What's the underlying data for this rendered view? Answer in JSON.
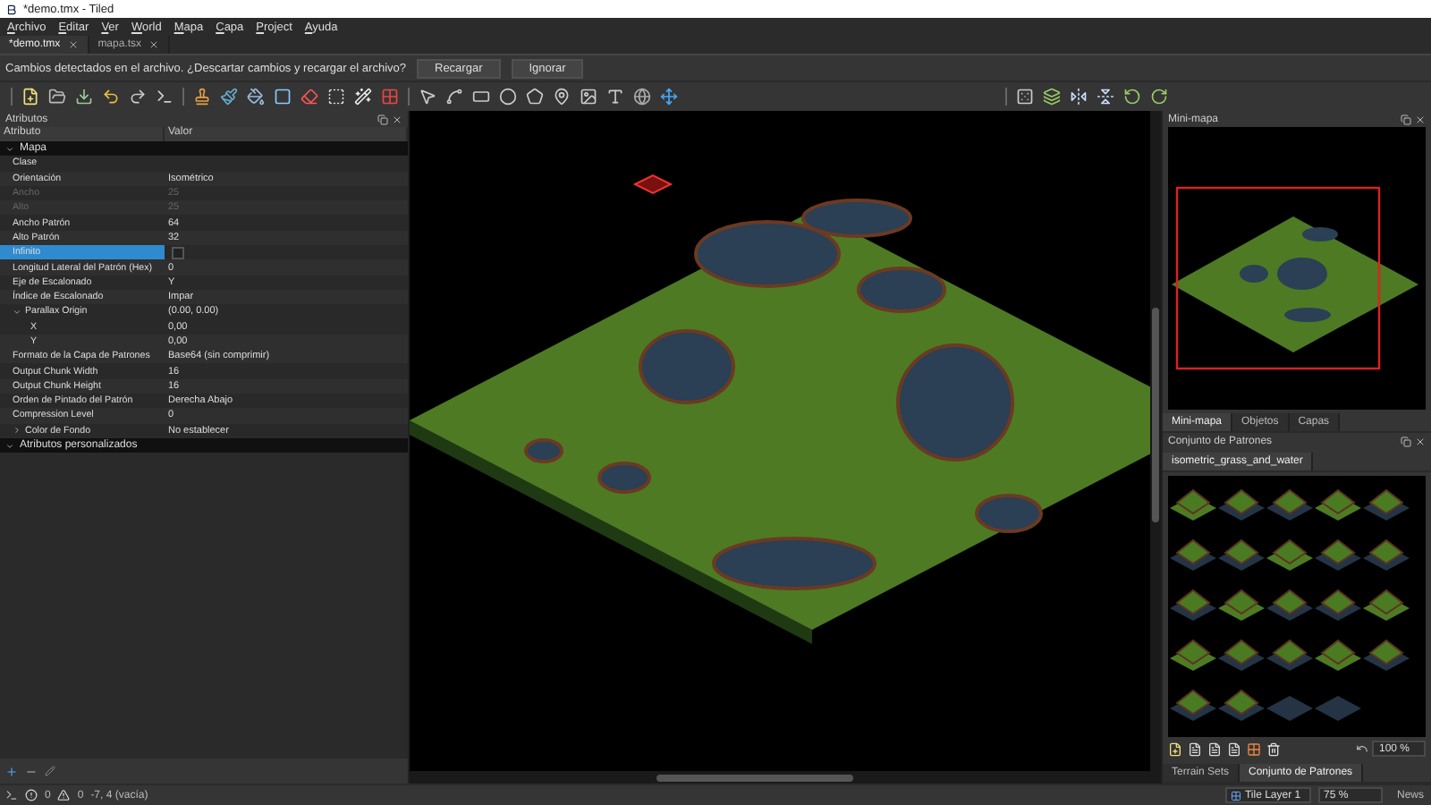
{
  "window": {
    "title": "*demo.tmx - Tiled"
  },
  "menu": [
    "Archivo",
    "Editar",
    "Ver",
    "World",
    "Mapa",
    "Capa",
    "Project",
    "Ayuda"
  ],
  "document_tabs": [
    {
      "label": "*demo.tmx",
      "selected": true
    },
    {
      "label": "mapa.tsx",
      "selected": false
    }
  ],
  "notification": {
    "message": "Cambios detectados en el archivo. ¿Descartar cambios y recargar el archivo?",
    "buttons": [
      "Recargar",
      "Ignorar"
    ]
  },
  "properties_panel": {
    "title": "Atributos",
    "columns": [
      "Atributo",
      "Valor"
    ],
    "groups": [
      {
        "name": "Mapa",
        "expanded": true,
        "rows": [
          {
            "kind": "text",
            "label": "Clase",
            "disabled": false,
            "selected": false
          },
          {
            "kind": "text",
            "label": "Orientación",
            "value": "Isométrico",
            "disabled": false,
            "selected": false
          },
          {
            "kind": "text",
            "label": "Ancho",
            "value": "25",
            "disabled": true,
            "selected": false
          },
          {
            "kind": "text",
            "label": "Alto",
            "value": "25",
            "disabled": true,
            "selected": false
          },
          {
            "kind": "text",
            "label": "Ancho Patrón",
            "value": "64",
            "disabled": false,
            "selected": false
          },
          {
            "kind": "text",
            "label": "Alto Patrón",
            "value": "32",
            "disabled": false,
            "selected": false
          },
          {
            "kind": "checkbox",
            "label": "Infinito",
            "checked": false,
            "disabled": false,
            "selected": true
          },
          {
            "kind": "text",
            "label": "Longitud Lateral del Patrón (Hex)",
            "value": "0",
            "disabled": false,
            "selected": false
          },
          {
            "kind": "text",
            "label": "Eje de Escalonado",
            "value": "Y",
            "disabled": false,
            "selected": false
          },
          {
            "kind": "text",
            "label": "Índice de Escalonado",
            "value": "Impar",
            "disabled": false,
            "selected": false
          },
          {
            "kind": "text",
            "label": "Parallax Origin",
            "value": "(0.00, 0.00)",
            "disabled": false,
            "selected": false,
            "expanded": true,
            "children": [
              {
                "kind": "text",
                "label": "X",
                "value": "0,00",
                "disabled": false,
                "selected": false
              },
              {
                "kind": "text",
                "label": "Y",
                "value": "0,00",
                "disabled": false,
                "selected": false
              }
            ]
          },
          {
            "kind": "text",
            "label": "Formato de la Capa de Patrones",
            "value": "Base64 (sin comprimir)",
            "disabled": false,
            "selected": false
          },
          {
            "kind": "text",
            "label": "Output Chunk Width",
            "value": "16",
            "disabled": false,
            "selected": false
          },
          {
            "kind": "text",
            "label": "Output Chunk Height",
            "value": "16",
            "disabled": false,
            "selected": false
          },
          {
            "kind": "text",
            "label": "Orden de Pintado del Patrón",
            "value": "Derecha Abajo",
            "disabled": false,
            "selected": false
          },
          {
            "kind": "text",
            "label": "Compression Level",
            "value": "0",
            "disabled": false,
            "selected": false
          },
          {
            "kind": "text",
            "label": "Color de Fondo",
            "value": "No establecer",
            "disabled": false,
            "selected": false,
            "expanded": false
          }
        ]
      },
      {
        "name": "Atributos personalizados",
        "expanded": true
      }
    ]
  },
  "minimap": {
    "title": "Mini-mapa"
  },
  "right_tabs": [
    {
      "label": "Mini-mapa",
      "selected": true
    },
    {
      "label": "Objetos",
      "selected": false
    },
    {
      "label": "Capas",
      "selected": false
    }
  ],
  "tileset_panel": {
    "title": "Conjunto de Patrones",
    "tabs": [
      {
        "label": "isometric_grass_and_water",
        "selected": true
      }
    ],
    "zoom": "100 %"
  },
  "bottom_tabs": [
    {
      "label": "Terrain Sets",
      "selected": false
    },
    {
      "label": "Conjunto de Patrones",
      "selected": true
    }
  ],
  "status_bar": {
    "errors": "0",
    "warnings": "0",
    "position": "-7, 4 (vacía)",
    "layer": "Tile Layer 1",
    "zoom": "75 %",
    "news": "News"
  }
}
